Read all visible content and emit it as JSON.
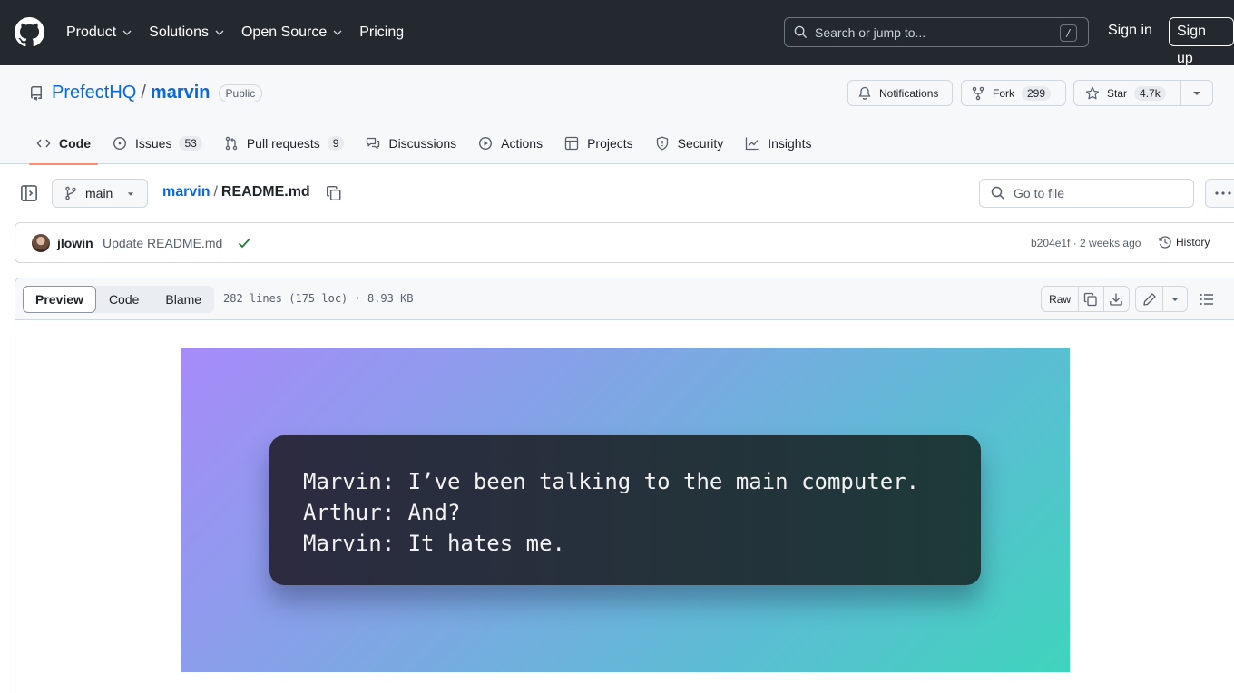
{
  "header": {
    "nav": [
      {
        "label": "Product",
        "has_menu": true
      },
      {
        "label": "Solutions",
        "has_menu": true
      },
      {
        "label": "Open Source",
        "has_menu": true
      },
      {
        "label": "Pricing",
        "has_menu": false
      }
    ],
    "search_placeholder": "Search or jump to...",
    "search_shortcut": "/",
    "sign_in": "Sign in",
    "sign_up": "Sign up"
  },
  "repo": {
    "owner": "PrefectHQ",
    "separator": "/",
    "name": "marvin",
    "visibility": "Public",
    "notifications_label": "Notifications",
    "fork_label": "Fork",
    "fork_count": "299",
    "star_label": "Star",
    "star_count": "4.7k",
    "tabs": [
      {
        "label": "Code",
        "count": "",
        "icon": "code-icon",
        "active": true
      },
      {
        "label": "Issues",
        "count": "53",
        "icon": "issue-icon",
        "active": false
      },
      {
        "label": "Pull requests",
        "count": "9",
        "icon": "pull-request-icon",
        "active": false
      },
      {
        "label": "Discussions",
        "count": "",
        "icon": "discussion-icon",
        "active": false
      },
      {
        "label": "Actions",
        "count": "",
        "icon": "play-icon",
        "active": false
      },
      {
        "label": "Projects",
        "count": "",
        "icon": "table-icon",
        "active": false
      },
      {
        "label": "Security",
        "count": "",
        "icon": "shield-icon",
        "active": false
      },
      {
        "label": "Insights",
        "count": "",
        "icon": "graph-icon",
        "active": false
      }
    ],
    "accent": "#0969da",
    "tab_underline": "#fd8c73"
  },
  "file_bar": {
    "branch": "main",
    "path_repo": "marvin",
    "path_sep": "/",
    "file_name": "README.md",
    "goto_placeholder": "Go to file"
  },
  "commit": {
    "author": "jlowin",
    "message": "Update README.md",
    "sha_time": "b204e1f · 2 weeks ago",
    "history_label": "History",
    "status_color": "#1a7f37"
  },
  "viewer": {
    "tabs": [
      "Preview",
      "Code",
      "Blame"
    ],
    "selected_tab": "Preview",
    "meta": "282 lines (175 loc) · 8.93 KB",
    "raw_label": "Raw"
  },
  "banner": {
    "lines": [
      "Marvin: I’ve been talking to the main computer.",
      "Arthur: And?",
      "Marvin: It hates me."
    ]
  }
}
